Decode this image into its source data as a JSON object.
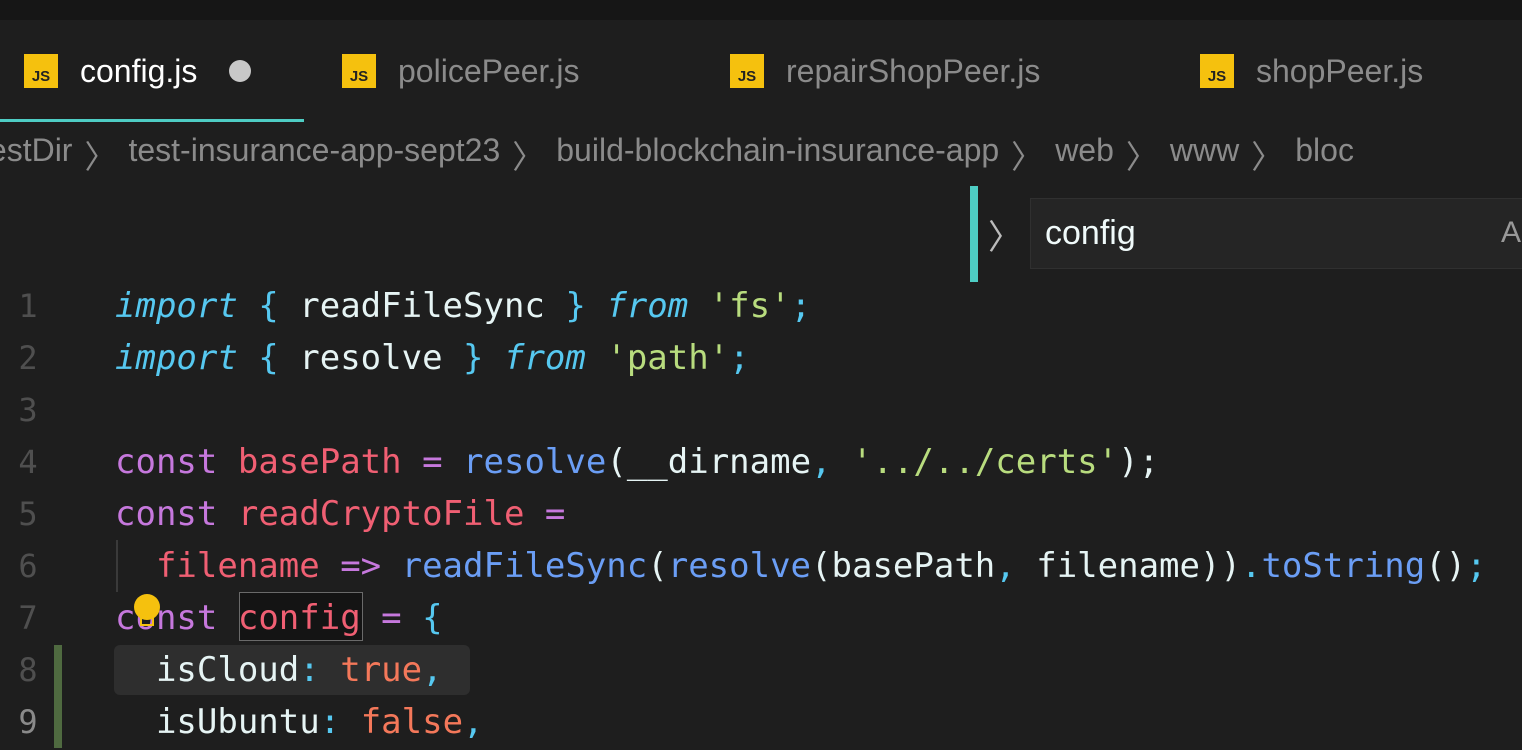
{
  "tabs": [
    {
      "label": "config.js",
      "icon": "js-icon",
      "active": true,
      "dirty": true
    },
    {
      "label": "policePeer.js",
      "icon": "js-icon"
    },
    {
      "label": "repairShopPeer.js",
      "icon": "js-icon"
    },
    {
      "label": "shopPeer.js",
      "icon": "js-icon"
    }
  ],
  "js_icon_label": "JS",
  "breadcrumb": [
    "testDir",
    "test-insurance-app-sept23",
    "build-blockchain-insurance-app",
    "web",
    "www",
    "bloc"
  ],
  "find": {
    "value": "config",
    "option_label": "A"
  },
  "code": [
    {
      "n": "1",
      "tokens": [
        [
          "import",
          "kw"
        ],
        [
          " { ",
          "cy"
        ],
        [
          "readFileSync",
          "tx"
        ],
        [
          " } ",
          "cy"
        ],
        [
          "from",
          "kw"
        ],
        [
          " ",
          "tx"
        ],
        [
          "'fs'",
          "st"
        ],
        [
          ";",
          "cy"
        ]
      ]
    },
    {
      "n": "2",
      "tokens": [
        [
          "import",
          "kw"
        ],
        [
          " { ",
          "cy"
        ],
        [
          "resolve",
          "tx"
        ],
        [
          " } ",
          "cy"
        ],
        [
          "from",
          "kw"
        ],
        [
          " ",
          "tx"
        ],
        [
          "'path'",
          "st"
        ],
        [
          ";",
          "cy"
        ]
      ]
    },
    {
      "n": "3",
      "tokens": []
    },
    {
      "n": "4",
      "tokens": [
        [
          "const",
          "pu"
        ],
        [
          " ",
          "tx"
        ],
        [
          "basePath",
          "va"
        ],
        [
          " = ",
          "pu"
        ],
        [
          "resolve",
          "fn"
        ],
        [
          "(",
          "tx"
        ],
        [
          "__dirname",
          "tx"
        ],
        [
          ", ",
          "cy"
        ],
        [
          "'../../certs'",
          "st"
        ],
        [
          ");",
          "tx"
        ]
      ]
    },
    {
      "n": "5",
      "tokens": [
        [
          "const",
          "pu"
        ],
        [
          " ",
          "tx"
        ],
        [
          "readCryptoFile",
          "va"
        ],
        [
          " =",
          "pu"
        ]
      ]
    },
    {
      "n": "6",
      "tokens": [
        [
          "  ",
          "tx"
        ],
        [
          "filename",
          "va"
        ],
        [
          " => ",
          "pu"
        ],
        [
          "readFileSync",
          "fn"
        ],
        [
          "(",
          "tx"
        ],
        [
          "resolve",
          "fn"
        ],
        [
          "(",
          "tx"
        ],
        [
          "basePath",
          "tx"
        ],
        [
          ", ",
          "cy"
        ],
        [
          "filename",
          "tx"
        ],
        [
          "))",
          "tx"
        ],
        [
          ".",
          "cy"
        ],
        [
          "toString",
          "fn"
        ],
        [
          "()",
          "tx"
        ],
        [
          ";",
          "cy"
        ]
      ]
    },
    {
      "n": "7",
      "tokens": [
        [
          "const",
          "pu"
        ],
        [
          " ",
          "tx"
        ],
        [
          "config",
          "va"
        ],
        [
          " = ",
          "pu"
        ],
        [
          "{",
          "cy"
        ]
      ]
    },
    {
      "n": "8",
      "tokens": [
        [
          "  ",
          "tx"
        ],
        [
          "isCloud",
          "tx"
        ],
        [
          ":",
          "cy"
        ],
        [
          " ",
          "tx"
        ],
        [
          "true",
          "bo"
        ],
        [
          ",",
          "cy"
        ]
      ]
    },
    {
      "n": "9",
      "tokens": [
        [
          "  ",
          "tx"
        ],
        [
          "isUbuntu",
          "tx"
        ],
        [
          ":",
          "cy"
        ],
        [
          " ",
          "tx"
        ],
        [
          "false",
          "bo"
        ],
        [
          ",",
          "cy"
        ]
      ]
    }
  ],
  "colors": {
    "accent": "#4ecdc4",
    "js_icon": "#f5c10e",
    "modified_gutter": "#4f6a40"
  }
}
